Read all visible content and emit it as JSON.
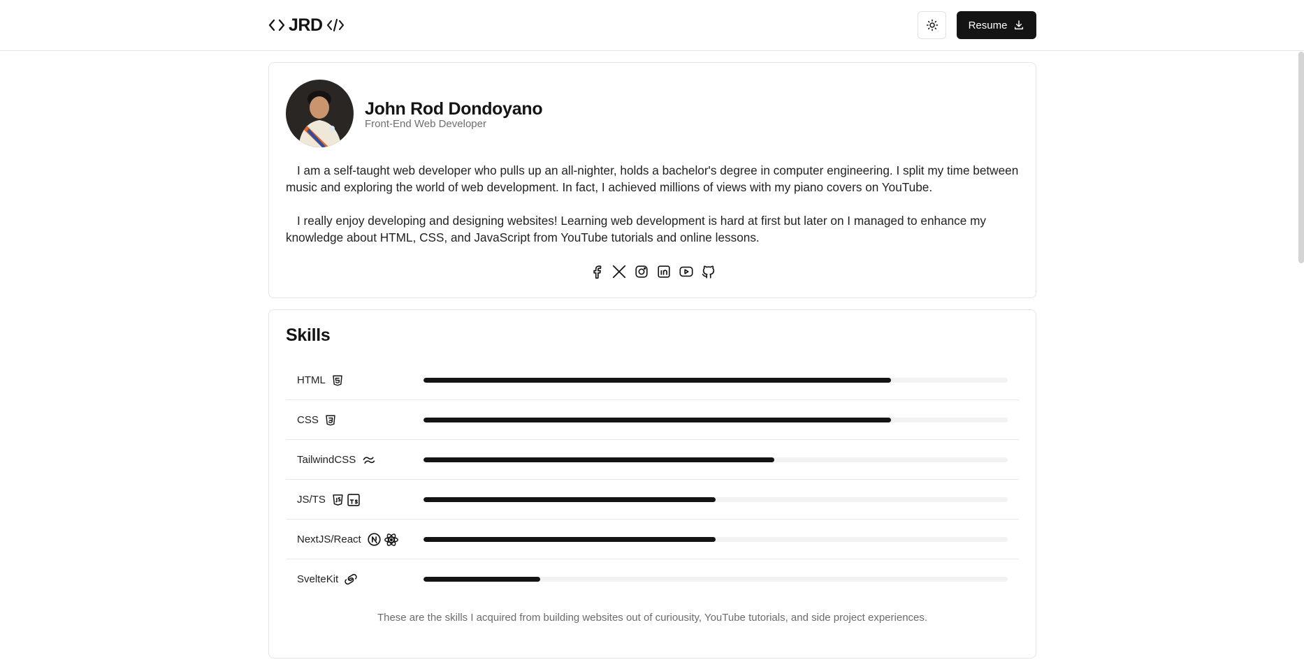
{
  "header": {
    "logo_text": "JRD",
    "theme_toggle_icon": "sun-icon",
    "resume_label": "Resume",
    "resume_icon": "download-icon"
  },
  "profile": {
    "avatar": "profile-photo",
    "name": "John Rod Dondoyano",
    "role": "Front-End Web Developer",
    "bio": [
      "I am a self-taught web developer who pulls up an all-nighter, holds a bachelor's degree in computer engineering. I split my time between music and exploring the world of web development. In fact, I achieved millions of views with my piano covers on YouTube.",
      "I really enjoy developing and designing websites! Learning web development is hard at first but later on I managed to enhance my knowledge about HTML, CSS, and JavaScript from YouTube tutorials and online lessons."
    ],
    "socials": [
      "facebook-icon",
      "x-icon",
      "instagram-icon",
      "linkedin-icon",
      "youtube-icon",
      "github-icon"
    ]
  },
  "skills": {
    "title": "Skills",
    "items": [
      {
        "label": "HTML",
        "level": 0.8,
        "icons": [
          "html5-icon"
        ]
      },
      {
        "label": "CSS",
        "level": 0.8,
        "icons": [
          "css3-icon"
        ]
      },
      {
        "label": "TailwindCSS",
        "level": 0.6,
        "icons": [
          "tailwind-icon"
        ]
      },
      {
        "label": "JS/TS",
        "level": 0.5,
        "icons": [
          "javascript-icon",
          "typescript-icon"
        ]
      },
      {
        "label": "NextJS/React",
        "level": 0.5,
        "icons": [
          "nextjs-icon",
          "react-icon"
        ]
      },
      {
        "label": "SvelteKit",
        "level": 0.2,
        "icons": [
          "svelte-icon"
        ]
      }
    ],
    "note": "These are the skills I acquired from building websites out of curiousity, YouTube tutorials, and side project experiences."
  }
}
